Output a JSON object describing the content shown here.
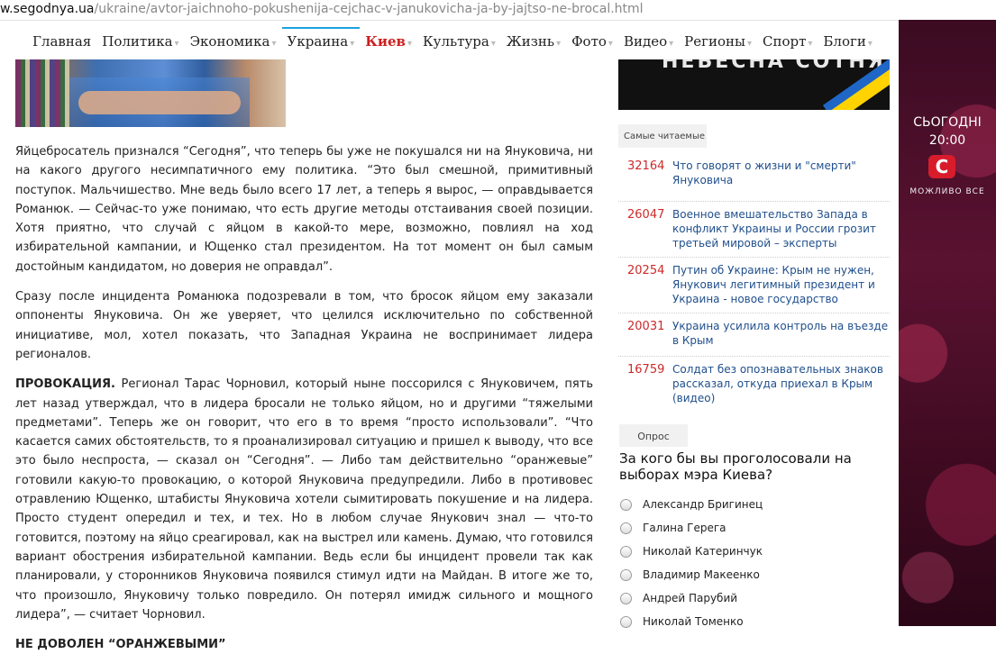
{
  "url": {
    "host": "w.segodnya.ua",
    "path": "/ukraine/avtor-jaichnoho-pokushenija-cejchac-v-janukovicha-ja-by-jajtso-ne-brocal.html"
  },
  "nav": {
    "items": [
      "Главная",
      "Политика",
      "Экономика",
      "Украина",
      "Киев",
      "Культура",
      "Жизнь",
      "Фото",
      "Видео",
      "Регионы",
      "Спорт",
      "Блоги"
    ],
    "active": "Украина"
  },
  "article": {
    "p1": "Яйцебросатель признался “Сегодня”, что теперь бы уже не покушался ни на Януковича, ни на какого другого несимпатичного ему политика. “Это был смешной, примитивный поступок. Мальчишество. Мне ведь было всего 17 лет, а теперь я вырос, — оправдывается Романюк. — Сейчас-то уже понимаю, что есть другие методы отстаивания своей позиции. Хотя приятно, что случай с яйцом в какой-то мере, возможно, повлиял на ход избирательной кампании, и Ющенко стал президентом. На тот момент он был самым достойным кандидатом, но доверия не оправдал”.",
    "p2": "Сразу после инцидента Романюка подозревали в том, что бросок яйцом ему заказали оппоненты Януковича. Он же уверяет, что целился исключительно по собственной инициативе, мол, хотел показать, что Западная Украина не воспринимает лидера регионалов.",
    "p3_lead": "ПРОВОКАЦИЯ.",
    "p3_text": " Регионал Тарас Чорновил, который ныне поссорился с Януковичем, пять лет назад утверждал, что в лидера бросали не только яйцом, но и другими “тяжелыми предметами”. Теперь же он говорит, что его в то время “просто использовали”. “Что касается самих обстоятельств, то я проанализировал ситуацию и пришел к выводу, что все это было неспроста, — сказал он “Сегодня”. — Либо там действительно “оранжевые” готовили какую-то провокацию, о которой Януковича предупредили. Либо в противовес отравлению Ющенко, штабисты Януковича хотели сымитировать покушение и на лидера. Просто студент опередил и тех, и тех. Но в любом случае Янукович знал — что-то готовится, поэтому на яйцо среагировал, как на выстрел или камень. Думаю, что готовился вариант обострения избирательной кампании. Ведь если бы инцидент провели так как планировали, у сторонников Януковича появился стимул идти на Майдан. В итоге же то, что произошло, Януковичу только повредило. Он потерял имидж сильного и мощного лидера”, — считает Чорновил.",
    "subhead": "НЕ ДОВОЛЕН “ОРАНЖЕВЫМИ”"
  },
  "banner_top": {
    "text": "НЕБЕСНА СОТНЯ"
  },
  "popular": {
    "tab": "Самые читаемые",
    "items": [
      {
        "count": "32164",
        "title": "Что говорят о жизни и \"смерти\" Януковича"
      },
      {
        "count": "26047",
        "title": "Военное вмешательство Запада в конфликт Украины и России грозит третьей мировой – эксперты"
      },
      {
        "count": "20254",
        "title": "Путин об Украине: Крым не нужен, Янукович легитимный президент и Украина - новое государство"
      },
      {
        "count": "20031",
        "title": "Украина усилила контроль на въезде в Крым"
      },
      {
        "count": "16759",
        "title": "Солдат без опознавательных знаков рассказал, откуда приехал в Крым (видео)"
      }
    ]
  },
  "poll": {
    "tab": "Опрос",
    "question": "За кого бы вы проголосовали на выборах мэра Киева?",
    "options": [
      "Александр Бригинец",
      "Галина Герега",
      "Николай Катеринчук",
      "Владимир Макеенко",
      "Андрей Парубий",
      "Николай Томенко"
    ]
  },
  "ad": {
    "line1": "СЬОГОДНІ",
    "line2": "20:00",
    "logo": "С",
    "line3": "МОЖЛИВО ВСЕ"
  },
  "colors": {
    "accent": "#1aa3e0",
    "kiev": "#cc1f1f",
    "count": "#cc2a2a",
    "link": "#1f4f8c"
  }
}
